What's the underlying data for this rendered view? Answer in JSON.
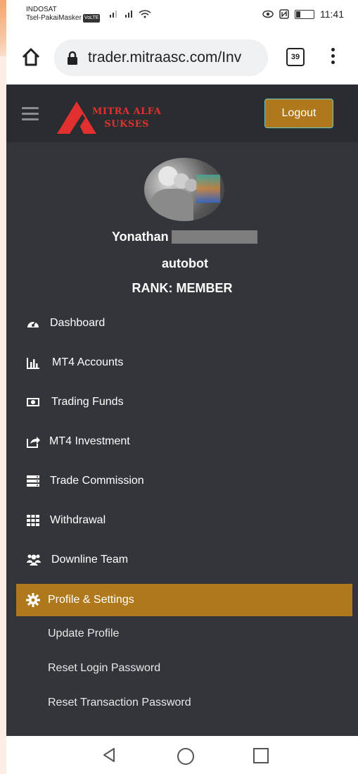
{
  "status_bar": {
    "carrier_1": "INDOSAT",
    "carrier_2": "Tsel-PakaiMasker",
    "volte": "VoLTE",
    "time": "11:41"
  },
  "browser": {
    "url": "trader.mitraasc.com/Inv",
    "tab_count": "39"
  },
  "header": {
    "logo_line1": "MITRA ALFA",
    "logo_line2": "SUKSES",
    "logout_label": "Logout"
  },
  "profile": {
    "first_name": "Yonathan",
    "group": "autobot",
    "rank": "RANK: MEMBER"
  },
  "nav": [
    {
      "label": "Dashboard",
      "icon": "dashboard-icon"
    },
    {
      "label": "MT4 Accounts",
      "icon": "bar-chart-icon"
    },
    {
      "label": "Trading Funds",
      "icon": "money-icon"
    },
    {
      "label": "MT4 Investment",
      "icon": "share-icon"
    },
    {
      "label": "Trade Commission",
      "icon": "server-icon"
    },
    {
      "label": "Withdrawal",
      "icon": "grid-icon"
    },
    {
      "label": "Downline Team",
      "icon": "users-icon"
    },
    {
      "label": "Profile & Settings",
      "icon": "gear-icon"
    }
  ],
  "submenu": [
    {
      "label": "Update Profile"
    },
    {
      "label": "Reset Login Password"
    },
    {
      "label": "Reset Transaction Password"
    }
  ],
  "colors": {
    "accent": "#b0781c",
    "sidebar_bg": "#33353a",
    "header_bg": "#2a2c30",
    "logo_red": "#e23030"
  }
}
